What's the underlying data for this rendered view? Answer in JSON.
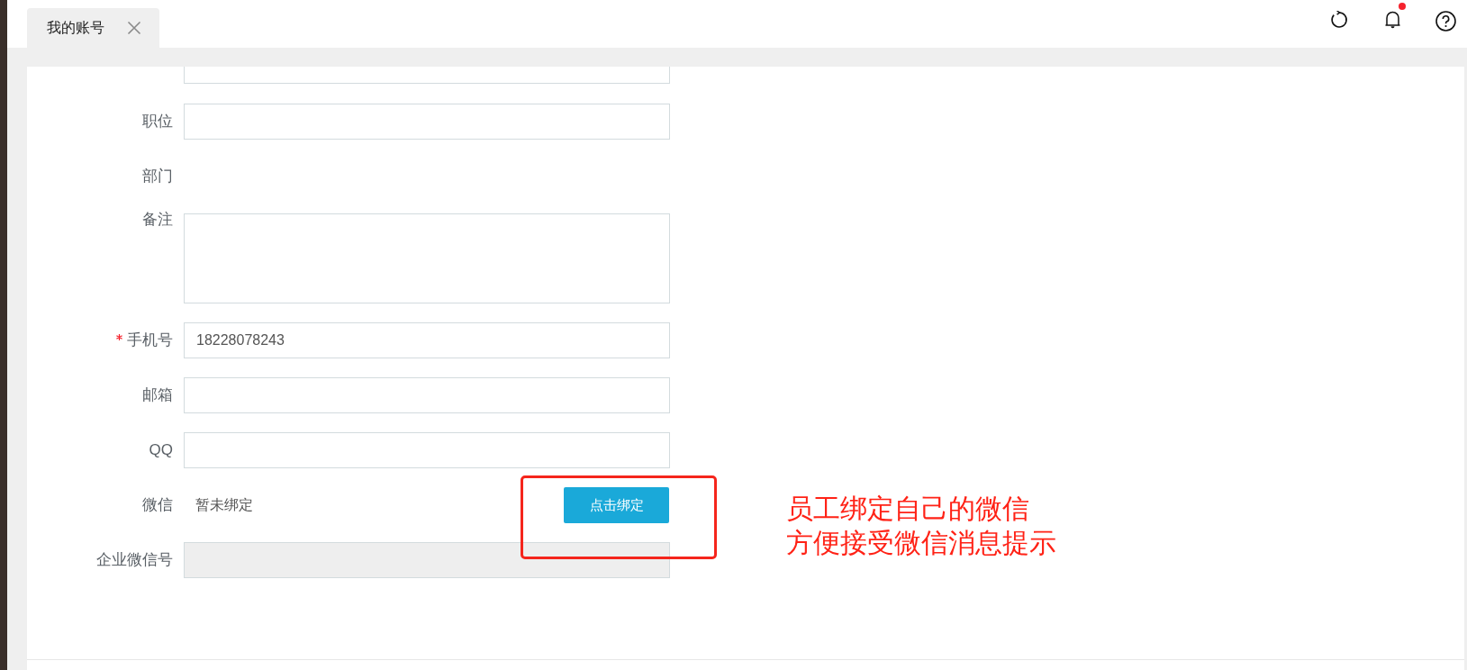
{
  "tabs": [
    {
      "label": "我的账号",
      "selected": true
    }
  ],
  "header": {
    "unread_notifications": true
  },
  "form": {
    "rows": [
      {
        "kind": "clipped",
        "disabled": false
      },
      {
        "kind": "input",
        "label": "职位",
        "required": false,
        "disabled": false
      },
      {
        "kind": "static",
        "label": "部门",
        "required": false
      },
      {
        "kind": "textarea",
        "label": "备注",
        "required": false
      },
      {
        "kind": "input",
        "label": "手机号",
        "required": true,
        "value": "18228078243",
        "disabled": false
      },
      {
        "kind": "input",
        "label": "邮箱",
        "required": false,
        "disabled": false
      },
      {
        "kind": "input",
        "label": "QQ",
        "required": false,
        "disabled": false
      },
      {
        "kind": "binding",
        "label": "微信",
        "required": false,
        "status": "暂未绑定",
        "button": "点击绑定"
      },
      {
        "kind": "input",
        "label": "企业微信号",
        "required": false,
        "disabled": true
      }
    ]
  },
  "annotation": {
    "lines": [
      "员工绑定自己的微信",
      "方便接受微信消息提示"
    ]
  }
}
